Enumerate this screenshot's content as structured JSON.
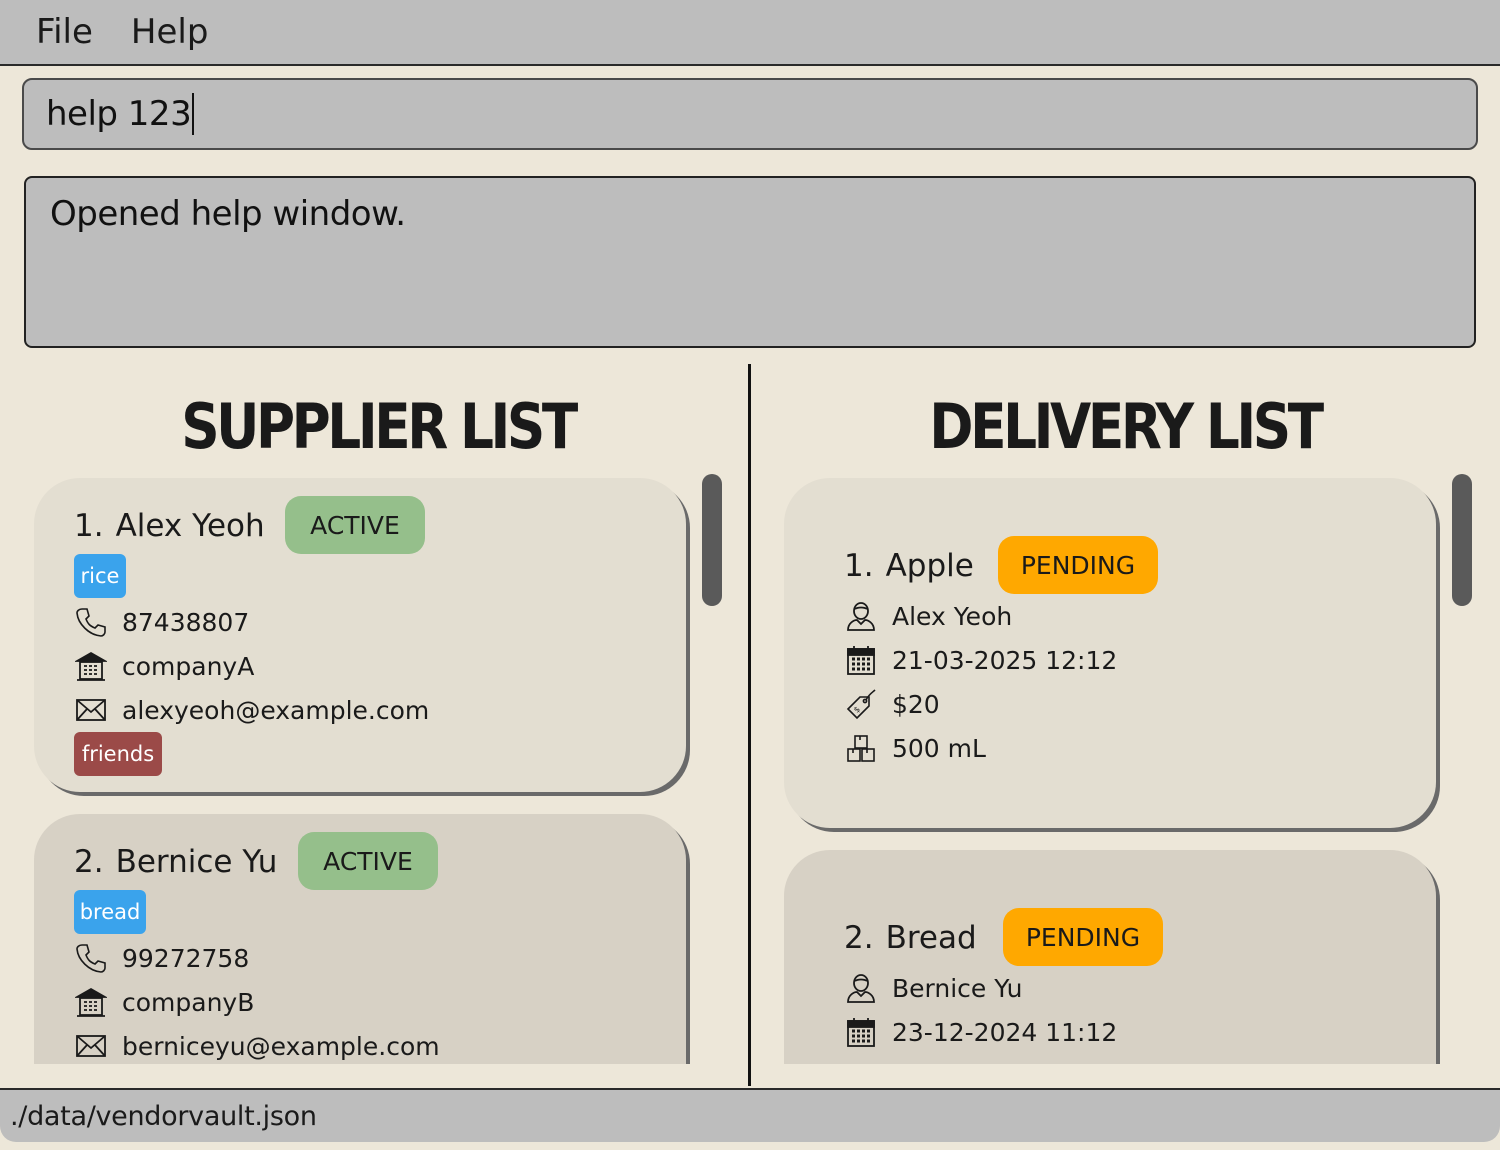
{
  "menu": {
    "file": "File",
    "help": "Help"
  },
  "command": {
    "value": "help 123"
  },
  "result": {
    "message": "Opened help window."
  },
  "supplier_panel": {
    "title": "SUPPLIER LIST",
    "suppliers": [
      {
        "index": "1.",
        "name": "Alex Yeoh",
        "status": "ACTIVE",
        "product_tag": "rice",
        "phone": "87438807",
        "company": "companyA",
        "email": "alexyeoh@example.com",
        "tag": "friends"
      },
      {
        "index": "2.",
        "name": "Bernice Yu",
        "status": "ACTIVE",
        "product_tag": "bread",
        "phone": "99272758",
        "company": "companyB",
        "email": "berniceyu@example.com"
      }
    ]
  },
  "delivery_panel": {
    "title": "DELIVERY LIST",
    "deliveries": [
      {
        "index": "1.",
        "product": "Apple",
        "status": "PENDING",
        "supplier": "Alex Yeoh",
        "datetime": "21-03-2025 12:12",
        "cost": "$20",
        "quantity": "500 mL"
      },
      {
        "index": "2.",
        "product": "Bread",
        "status": "PENDING",
        "supplier": "Bernice Yu",
        "datetime": "23-12-2024 11:12"
      }
    ]
  },
  "statusbar": {
    "path": "./data/vendorvault.json"
  },
  "colors": {
    "background": "#ede7d9",
    "active": "#95bf8b",
    "pending": "#ffa800",
    "tag_blue": "#3aa3ec",
    "tag_red": "#9b4a48"
  }
}
